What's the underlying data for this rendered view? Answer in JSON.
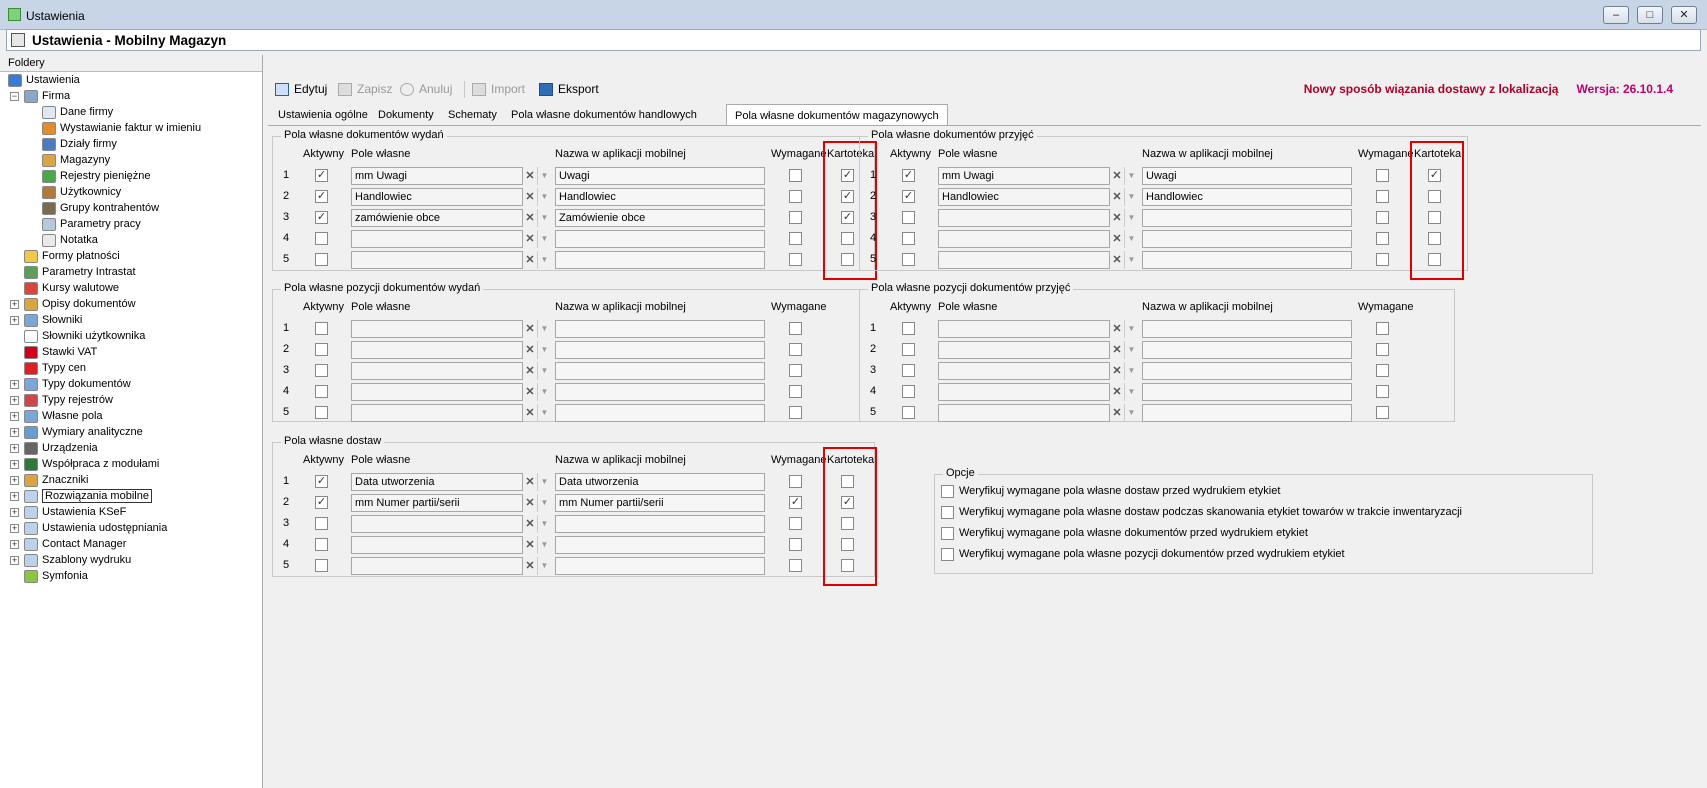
{
  "window": {
    "title": "Ustawienia",
    "minimize": "–",
    "maximize": "□",
    "close": "✕"
  },
  "app_header": {
    "title": "Ustawienia - Mobilny Magazyn"
  },
  "folders": {
    "label": "Foldery"
  },
  "tree": [
    {
      "label": "Ustawienia",
      "level": 0,
      "icon": "settings-icon",
      "color": "#3a7bd5"
    },
    {
      "label": "Firma",
      "level": 1,
      "icon": "company-icon",
      "color": "#8aa6c9",
      "exp": "−"
    },
    {
      "label": "Dane firmy",
      "level": 2,
      "icon": "document-icon",
      "color": "#dfe7f2"
    },
    {
      "label": "Wystawianie faktur w imieniu",
      "level": 2,
      "icon": "user-icon",
      "color": "#e58a2d"
    },
    {
      "label": "Działy firmy",
      "level": 2,
      "icon": "department-icon",
      "color": "#4b7cc1"
    },
    {
      "label": "Magazyny",
      "level": 2,
      "icon": "warehouse-icon",
      "color": "#d9a441"
    },
    {
      "label": "Rejestry pieniężne",
      "level": 2,
      "icon": "money-icon",
      "color": "#49a84a"
    },
    {
      "label": "Użytkownicy",
      "level": 2,
      "icon": "users-icon",
      "color": "#b47a3c"
    },
    {
      "label": "Grupy kontrahentów",
      "level": 2,
      "icon": "groups-icon",
      "color": "#7a6a4f"
    },
    {
      "label": "Parametry pracy",
      "level": 2,
      "icon": "params-icon",
      "color": "#b7c7dc"
    },
    {
      "label": "Notatka",
      "level": 2,
      "icon": "note-icon",
      "color": "#e9e9e9"
    },
    {
      "label": "Formy płatności",
      "level": 1,
      "icon": "payment-icon",
      "color": "#f0c94a"
    },
    {
      "label": "Parametry Intrastat",
      "level": 1,
      "icon": "intrastat-icon",
      "color": "#5aa05a"
    },
    {
      "label": "Kursy walutowe",
      "level": 1,
      "icon": "chart-icon",
      "color": "#d8463b"
    },
    {
      "label": "Opisy dokumentów",
      "level": 1,
      "icon": "docs-icon",
      "color": "#d9a441",
      "exp": "+"
    },
    {
      "label": "Słowniki",
      "level": 1,
      "icon": "dictionary-icon",
      "color": "#7aa6d8",
      "exp": "+"
    },
    {
      "label": "Słowniki użytkownika",
      "level": 1,
      "icon": "user-dictionary-icon",
      "color": "#ffffff"
    },
    {
      "label": "Stawki VAT",
      "level": 1,
      "icon": "vat-icon",
      "color": "#d0021b"
    },
    {
      "label": "Typy cen",
      "level": 1,
      "icon": "price-icon",
      "color": "#e02020"
    },
    {
      "label": "Typy dokumentów",
      "level": 1,
      "icon": "doctype-icon",
      "color": "#7aa6d8",
      "exp": "+"
    },
    {
      "label": "Typy rejestrów",
      "level": 1,
      "icon": "register-icon",
      "color": "#d0454a",
      "exp": "+"
    },
    {
      "label": "Własne pola",
      "level": 1,
      "icon": "fields-icon",
      "color": "#7aa6d8",
      "exp": "+"
    },
    {
      "label": "Wymiary analityczne",
      "level": 1,
      "icon": "dimensions-icon",
      "color": "#6a9bd3",
      "exp": "+"
    },
    {
      "label": "Urządzenia",
      "level": 1,
      "icon": "printer-icon",
      "color": "#666666",
      "exp": "+"
    },
    {
      "label": "Współpraca z modułami",
      "level": 1,
      "icon": "modules-icon",
      "color": "#2b7a3b",
      "exp": "+"
    },
    {
      "label": "Znaczniki",
      "level": 1,
      "icon": "tags-icon",
      "color": "#d9a441",
      "exp": "+"
    },
    {
      "label": "Rozwiązania mobilne",
      "level": 1,
      "icon": "folder-icon",
      "color": "#bcd2ea",
      "exp": "+",
      "selected": true
    },
    {
      "label": "Ustawienia KSeF",
      "level": 1,
      "icon": "folder-icon",
      "color": "#bcd2ea",
      "exp": "+"
    },
    {
      "label": "Ustawienia udostępniania",
      "level": 1,
      "icon": "folder-icon",
      "color": "#bcd2ea",
      "exp": "+"
    },
    {
      "label": "Contact Manager",
      "level": 1,
      "icon": "folder-icon",
      "color": "#bcd2ea",
      "exp": "+"
    },
    {
      "label": "Szablony wydruku",
      "level": 1,
      "icon": "folder-icon",
      "color": "#bcd2ea",
      "exp": "+"
    },
    {
      "label": "Symfonia",
      "level": 1,
      "icon": "symfonia-icon",
      "color": "#8cc63f"
    }
  ],
  "toolbar": {
    "edit": "Edytuj",
    "save": "Zapisz",
    "cancel": "Anuluj",
    "import": "Import",
    "export": "Eksport",
    "notice": "Nowy sposób wiązania dostawy z lokalizacją",
    "version": "Wersja: 26.10.1.4"
  },
  "tabs": [
    "Ustawienia ogólne",
    "Dokumenty",
    "Schematy",
    "Pola własne dokumentów handlowych",
    "Pola własne dokumentów magazynowych"
  ],
  "columns": {
    "active": "Aktywny",
    "field": "Pole własne",
    "name": "Nazwa w aplikacji mobilnej",
    "required": "Wymagane",
    "card": "Kartoteka"
  },
  "groups": [
    {
      "key": "wydan",
      "title": "Pola własne dokumentów wydań",
      "has_card": true,
      "rows": [
        {
          "n": "1",
          "active": true,
          "field": "mm Uwagi",
          "name": "Uwagi",
          "required": false,
          "card": true
        },
        {
          "n": "2",
          "active": true,
          "field": "Handlowiec",
          "name": "Handlowiec",
          "required": false,
          "card": true
        },
        {
          "n": "3",
          "active": true,
          "field": "zamówienie obce",
          "name": "Zamówienie obce",
          "required": false,
          "card": true
        },
        {
          "n": "4",
          "active": false,
          "field": "",
          "name": "",
          "required": false,
          "card": false
        },
        {
          "n": "5",
          "active": false,
          "field": "",
          "name": "",
          "required": false,
          "card": false
        }
      ]
    },
    {
      "key": "przyjec",
      "title": "Pola własne dokumentów przyjęć",
      "has_card": true,
      "rows": [
        {
          "n": "1",
          "active": true,
          "field": "mm Uwagi",
          "name": "Uwagi",
          "required": false,
          "card": true
        },
        {
          "n": "2",
          "active": true,
          "field": "Handlowiec",
          "name": "Handlowiec",
          "required": false,
          "card": false
        },
        {
          "n": "3",
          "active": false,
          "field": "",
          "name": "",
          "required": false,
          "card": false
        },
        {
          "n": "4",
          "active": false,
          "field": "",
          "name": "",
          "required": false,
          "card": false
        },
        {
          "n": "5",
          "active": false,
          "field": "",
          "name": "",
          "required": false,
          "card": false
        }
      ]
    },
    {
      "key": "poz_wydan",
      "title": "Pola własne pozycji dokumentów wydań",
      "has_card": false,
      "rows": [
        {
          "n": "1",
          "active": false,
          "field": "",
          "name": "",
          "required": false
        },
        {
          "n": "2",
          "active": false,
          "field": "",
          "name": "",
          "required": false
        },
        {
          "n": "3",
          "active": false,
          "field": "",
          "name": "",
          "required": false
        },
        {
          "n": "4",
          "active": false,
          "field": "",
          "name": "",
          "required": false
        },
        {
          "n": "5",
          "active": false,
          "field": "",
          "name": "",
          "required": false
        }
      ]
    },
    {
      "key": "poz_przyjec",
      "title": "Pola własne pozycji dokumentów przyjęć",
      "has_card": false,
      "rows": [
        {
          "n": "1",
          "active": false,
          "field": "",
          "name": "",
          "required": false
        },
        {
          "n": "2",
          "active": false,
          "field": "",
          "name": "",
          "required": false
        },
        {
          "n": "3",
          "active": false,
          "field": "",
          "name": "",
          "required": false
        },
        {
          "n": "4",
          "active": false,
          "field": "",
          "name": "",
          "required": false
        },
        {
          "n": "5",
          "active": false,
          "field": "",
          "name": "",
          "required": false
        }
      ]
    },
    {
      "key": "dostaw",
      "title": "Pola własne dostaw",
      "has_card": true,
      "rows": [
        {
          "n": "1",
          "active": true,
          "field": "Data utworzenia",
          "name": "Data utworzenia",
          "required": false,
          "card": false
        },
        {
          "n": "2",
          "active": true,
          "field": "mm Numer partii/serii",
          "name": "mm Numer partii/serii",
          "required": true,
          "card": true
        },
        {
          "n": "3",
          "active": false,
          "field": "",
          "name": "",
          "required": false,
          "card": false
        },
        {
          "n": "4",
          "active": false,
          "field": "",
          "name": "",
          "required": false,
          "card": false
        },
        {
          "n": "5",
          "active": false,
          "field": "",
          "name": "",
          "required": false,
          "card": false
        }
      ]
    }
  ],
  "options": {
    "title": "Opcje",
    "items": [
      {
        "label": "Weryfikuj wymagane pola własne dostaw przed wydrukiem etykiet",
        "checked": false
      },
      {
        "label": "Weryfikuj wymagane pola własne dostaw podczas skanowania etykiet towarów w trakcie inwentaryzacji",
        "checked": false
      },
      {
        "label": "Weryfikuj wymagane pola własne dokumentów przed wydrukiem etykiet",
        "checked": false
      },
      {
        "label": "Weryfikuj wymagane pola własne pozycji dokumentów przed wydrukiem etykiet",
        "checked": false
      }
    ]
  },
  "glyphs": {
    "check": "✓",
    "clear": "✕",
    "dropdown": "▼"
  },
  "colors": {
    "highlight_border": "#e00000",
    "notice": "#b0002a",
    "version": "#c0006f"
  }
}
